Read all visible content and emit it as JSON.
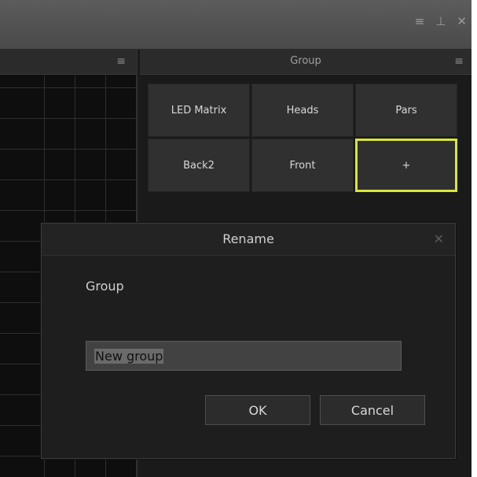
{
  "window": {
    "menu_icon": "≡",
    "pin_icon": "⊥",
    "close_icon": "✕"
  },
  "left_panel": {
    "menu_icon": "≡"
  },
  "group_panel": {
    "title": "Group",
    "menu_icon": "≡",
    "groups": [
      "LED Matrix",
      "Heads",
      "Pars",
      "Back2",
      "Front"
    ],
    "add_label": "+",
    "add_highlight_color": "#d8e63a"
  },
  "dialog": {
    "title": "Rename",
    "close_icon": "✕",
    "field_label": "Group",
    "input_value": "New group",
    "ok_label": "OK",
    "cancel_label": "Cancel"
  }
}
